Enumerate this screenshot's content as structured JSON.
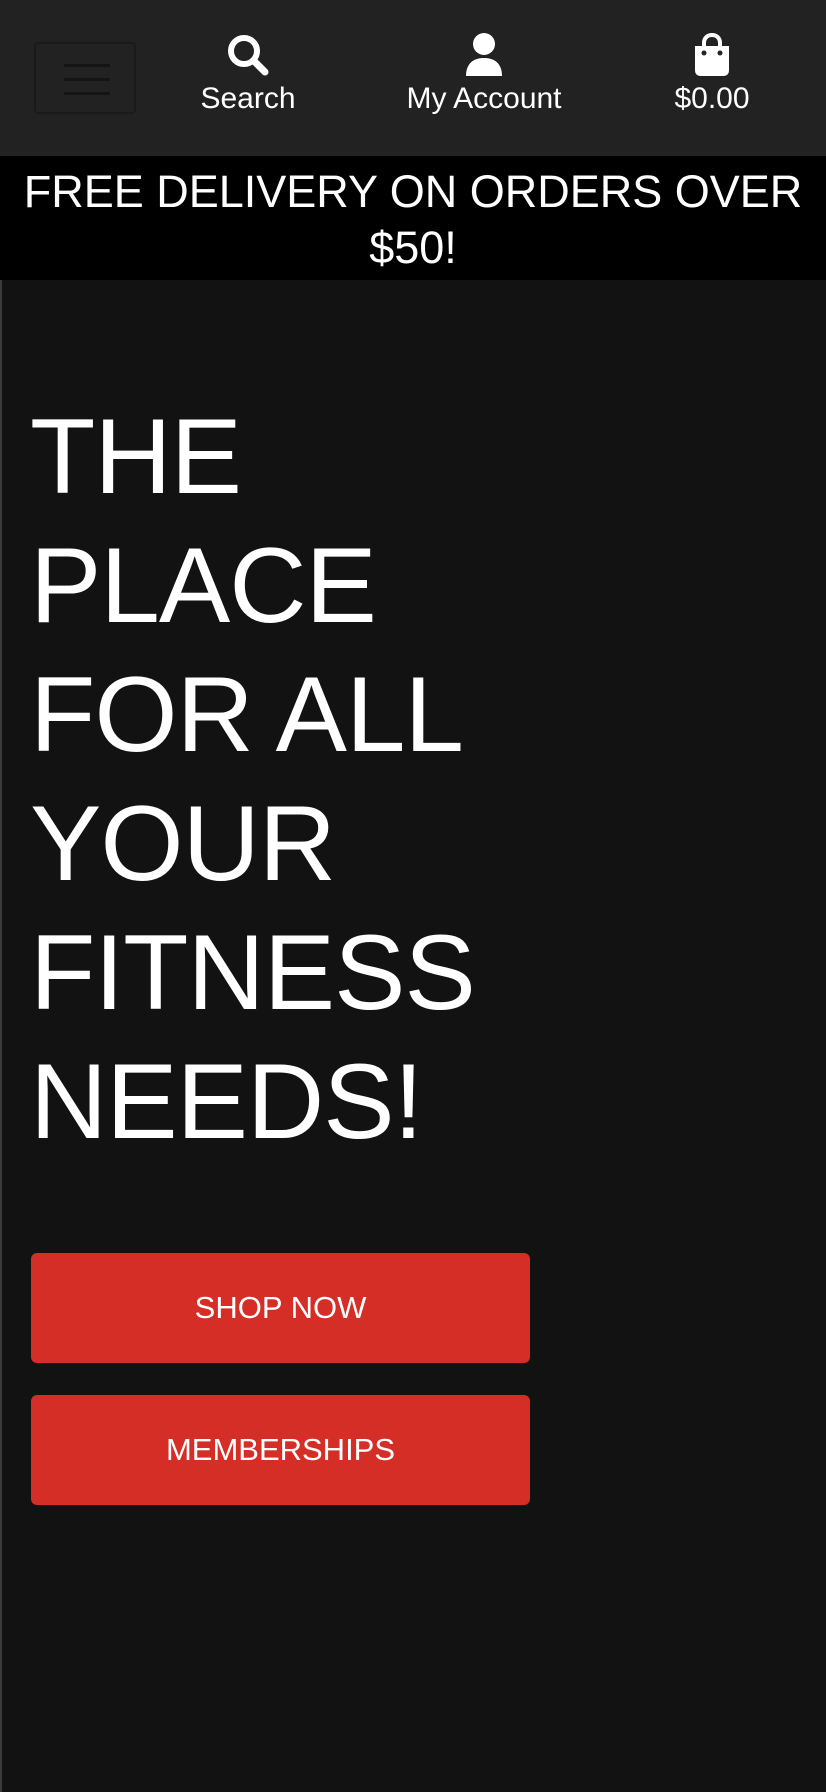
{
  "navbar": {
    "search_label": "Search",
    "account_label": "My Account",
    "cart_total": "$0.00",
    "icons": {
      "menu": "hamburger-icon",
      "search": "magnifier-icon",
      "account": "user-icon",
      "cart": "shopping-bag-icon"
    }
  },
  "banner": {
    "line1": "FREE DELIVERY ON ORDERS OVER",
    "line2": "$50!"
  },
  "hero": {
    "title_lines": [
      "THE",
      "PLACE",
      "FOR ALL",
      "YOUR",
      "FITNESS",
      "NEEDS!"
    ]
  },
  "buttons": {
    "shop_now": "SHOP NOW",
    "memberships": "MEMBERSHIPS"
  },
  "colors": {
    "page_background": "#121212",
    "navbar_background": "#222222",
    "banner_background": "#000000",
    "accent_button": "#d42e26",
    "text": "#ffffff"
  }
}
